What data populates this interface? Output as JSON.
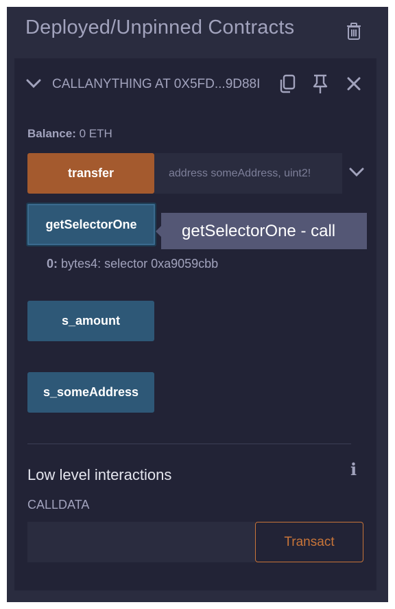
{
  "panel": {
    "title": "Deployed/Unpinned Contracts"
  },
  "contract": {
    "name": "CALLANYTHING AT 0X5FD...9D88I",
    "balance_label": "Balance:",
    "balance_value": "0 ETH"
  },
  "functions": {
    "transfer": {
      "label": "transfer",
      "placeholder": "address someAddress, uint2!"
    },
    "getSelectorOne": {
      "label": "getSelectorOne",
      "tooltip": "getSelectorOne - call",
      "result_index": "0:",
      "result_value": "bytes4: selector 0xa9059cbb"
    },
    "s_amount": {
      "label": "s_amount"
    },
    "s_someAddress": {
      "label": "s_someAddress"
    }
  },
  "low_level": {
    "title": "Low level interactions",
    "info_glyph": "i",
    "calldata_label": "CALLDATA",
    "transact_label": "Transact"
  },
  "colors": {
    "panel_bg": "#2a2c3f",
    "card_bg": "#222336",
    "transact_accent": "#c97539",
    "call_button": "#2e5877",
    "transact_button": "#a45a2e"
  },
  "icons": [
    "trash-icon",
    "chevron-down-icon",
    "copy-icon",
    "pin-icon",
    "close-icon",
    "info-icon"
  ]
}
